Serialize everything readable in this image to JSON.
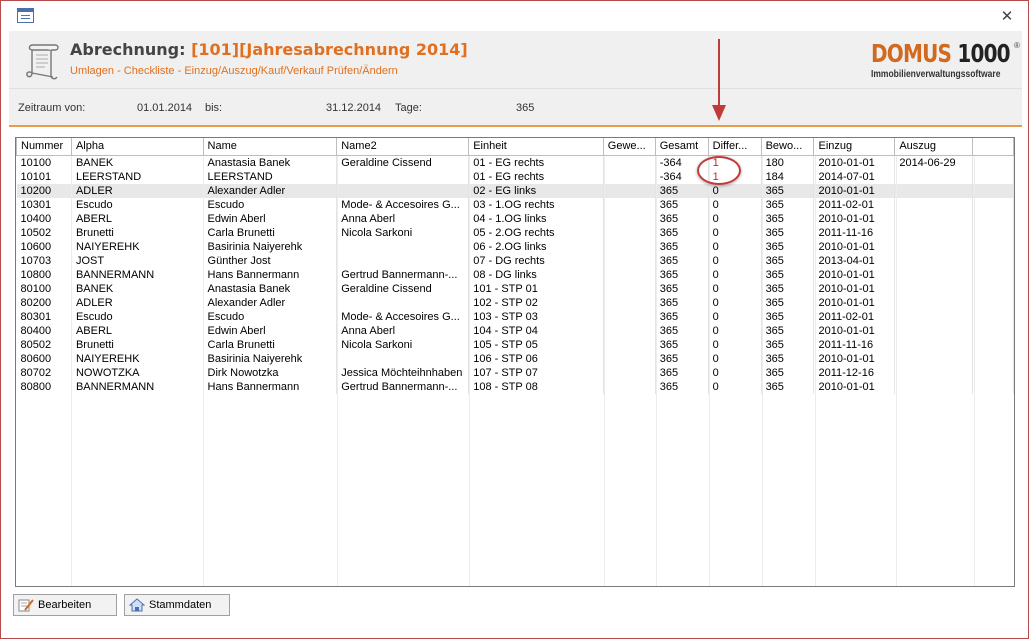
{
  "window": {
    "close_glyph": "✕"
  },
  "header": {
    "title_prefix": "Abrechnung:",
    "title_name": "[101][Jahresabrechnung 2014]",
    "subtitle": "Umlagen - Checkliste - Einzug/Auszug/Kauf/Verkauf Prüfen/Ändern",
    "logo": {
      "brand": "DOMUS",
      "number": "1000",
      "registered": "®",
      "tagline": "Immobilienverwaltungssoftware"
    }
  },
  "zeitraum": {
    "von_label": "Zeitraum von:",
    "von_value": "01.01.2014",
    "bis_label": "bis:",
    "bis_value": "31.12.2014",
    "tage_label": "Tage:",
    "tage_value": "365"
  },
  "grid": {
    "columns": [
      "Nummer",
      "Alpha",
      "Name",
      "Name2",
      "Einheit",
      "Gewe...",
      "Gesamt",
      "Differ...",
      "Bewo...",
      "Einzug",
      "Auszug"
    ],
    "rows": [
      [
        "10100",
        "BANEK",
        "Anastasia Banek",
        "Geraldine Cissend",
        "01 - EG rechts",
        "",
        "-364",
        "1",
        "180",
        "2010-01-01",
        "2014-06-29"
      ],
      [
        "10101",
        "LEERSTAND",
        "LEERSTAND",
        "",
        "01 - EG rechts",
        "",
        "-364",
        "1",
        "184",
        "2014-07-01",
        ""
      ],
      [
        "10200",
        "ADLER",
        "Alexander Adler",
        "",
        "02 - EG links",
        "",
        "365",
        "0",
        "365",
        "2010-01-01",
        ""
      ],
      [
        "10301",
        "Escudo",
        "Escudo",
        "Mode- & Accesoires G...",
        "03 - 1.OG rechts",
        "",
        "365",
        "0",
        "365",
        "2011-02-01",
        ""
      ],
      [
        "10400",
        "ABERL",
        "Edwin Aberl",
        "Anna Aberl",
        "04 - 1.OG links",
        "",
        "365",
        "0",
        "365",
        "2010-01-01",
        ""
      ],
      [
        "10502",
        "Brunetti",
        "Carla Brunetti",
        "Nicola Sarkoni",
        "05 - 2.OG rechts",
        "",
        "365",
        "0",
        "365",
        "2011-11-16",
        ""
      ],
      [
        "10600",
        "NAIYEREHK",
        "Basirinia Naiyerehk",
        "",
        "06 - 2.OG links",
        "",
        "365",
        "0",
        "365",
        "2010-01-01",
        ""
      ],
      [
        "10703",
        "JOST",
        "Günther Jost",
        "",
        "07 - DG rechts",
        "",
        "365",
        "0",
        "365",
        "2013-04-01",
        ""
      ],
      [
        "10800",
        "BANNERMANN",
        "Hans Bannermann",
        "Gertrud Bannermann-...",
        "08 - DG links",
        "",
        "365",
        "0",
        "365",
        "2010-01-01",
        ""
      ],
      [
        "80100",
        "BANEK",
        "Anastasia Banek",
        "Geraldine Cissend",
        "101 - STP 01",
        "",
        "365",
        "0",
        "365",
        "2010-01-01",
        ""
      ],
      [
        "80200",
        "ADLER",
        "Alexander Adler",
        "",
        "102 - STP 02",
        "",
        "365",
        "0",
        "365",
        "2010-01-01",
        ""
      ],
      [
        "80301",
        "Escudo",
        "Escudo",
        "Mode- & Accesoires G...",
        "103 - STP 03",
        "",
        "365",
        "0",
        "365",
        "2011-02-01",
        ""
      ],
      [
        "80400",
        "ABERL",
        "Edwin Aberl",
        "Anna Aberl",
        "104 - STP 04",
        "",
        "365",
        "0",
        "365",
        "2010-01-01",
        ""
      ],
      [
        "80502",
        "Brunetti",
        "Carla Brunetti",
        "Nicola Sarkoni",
        "105 - STP 05",
        "",
        "365",
        "0",
        "365",
        "2011-11-16",
        ""
      ],
      [
        "80600",
        "NAIYEREHK",
        "Basirinia Naiyerehk",
        "",
        "106 - STP 06",
        "",
        "365",
        "0",
        "365",
        "2010-01-01",
        ""
      ],
      [
        "80702",
        "NOWOTZKA",
        "Dirk Nowotzka",
        "Jessica Möchteihnhaben",
        "107 - STP 07",
        "",
        "365",
        "0",
        "365",
        "2011-12-16",
        ""
      ],
      [
        "80800",
        "BANNERMANN",
        "Hans Bannermann",
        "Gertrud Bannermann-...",
        "108 - STP 08",
        "",
        "365",
        "0",
        "365",
        "2010-01-01",
        ""
      ]
    ],
    "selected_row": 2,
    "highlight_color": "#d02020"
  },
  "buttons": {
    "edit_label": "Bearbeiten",
    "master_label": "Stammdaten"
  },
  "annotations": {
    "circle_color": "#c03a3a",
    "arrow_color": "#c03a3a"
  }
}
